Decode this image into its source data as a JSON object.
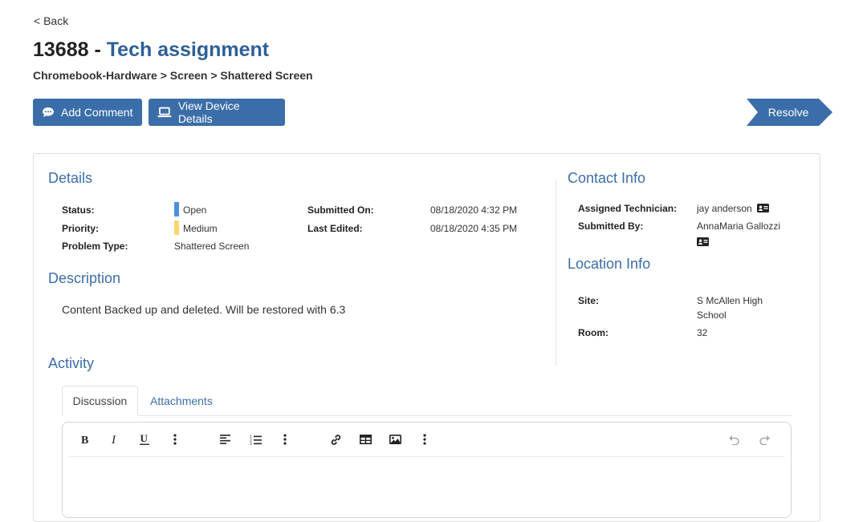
{
  "nav": {
    "back": "< Back"
  },
  "header": {
    "ticket_number": "13688",
    "separator": " - ",
    "ticket_name": "Tech assignment",
    "breadcrumb": "Chromebook-Hardware > Screen > Shattered Screen"
  },
  "actions": {
    "add_comment": "Add Comment",
    "view_device": "View Device Details",
    "resolve": "Resolve"
  },
  "details": {
    "heading": "Details",
    "status_label": "Status:",
    "status_value": "Open",
    "status_color": "#4a90d9",
    "priority_label": "Priority:",
    "priority_value": "Medium",
    "priority_color": "#f5d76e",
    "problem_type_label": "Problem Type:",
    "problem_type_value": "Shattered Screen",
    "submitted_on_label": "Submitted On:",
    "submitted_on_value": "08/18/2020 4:32 PM",
    "last_edited_label": "Last Edited:",
    "last_edited_value": "08/18/2020 4:35 PM"
  },
  "description": {
    "heading": "Description",
    "text": "Content Backed up and deleted. Will be restored with 6.3"
  },
  "contact": {
    "heading": "Contact Info",
    "assigned_label": "Assigned Technician:",
    "assigned_value": "jay anderson",
    "submitted_by_label": "Submitted By:",
    "submitted_by_value": "AnnaMaria Gallozzi"
  },
  "location": {
    "heading": "Location Info",
    "site_label": "Site:",
    "site_line1": "S McAllen High",
    "site_line2": "School",
    "room_label": "Room:",
    "room_value": "32"
  },
  "activity": {
    "heading": "Activity",
    "tabs": [
      "Discussion",
      "Attachments"
    ]
  },
  "editor": {
    "toolbar_icons": [
      "bold-icon",
      "italic-icon",
      "underline-icon",
      "more-icon",
      "align-left-icon",
      "numbered-list-icon",
      "more-icon",
      "link-icon",
      "table-icon",
      "image-icon",
      "more-icon",
      "undo-icon",
      "redo-icon"
    ]
  },
  "colors": {
    "accent": "#3b6ea8",
    "heading": "#2e5f98"
  }
}
